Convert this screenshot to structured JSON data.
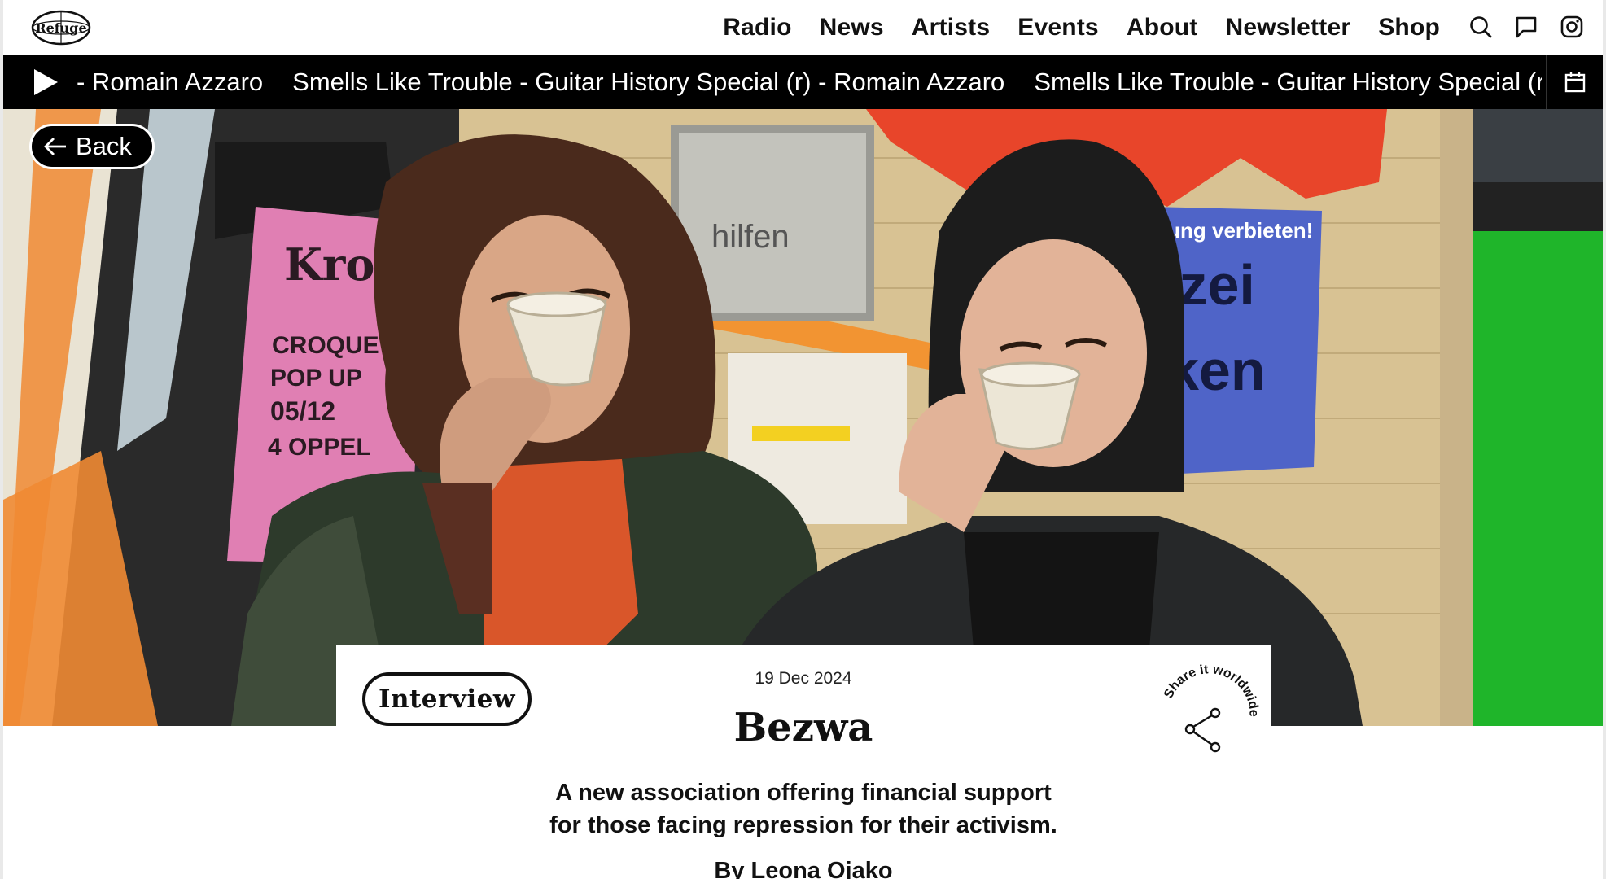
{
  "header": {
    "logo_text": "Refuge",
    "nav": [
      "Radio",
      "News",
      "Artists",
      "Events",
      "About",
      "Newsletter",
      "Shop"
    ],
    "icons": [
      "search-icon",
      "chat-icon",
      "instagram-icon"
    ]
  },
  "ticker": {
    "items": [
      "- Romain Azzaro",
      "Smells Like Trouble - Guitar History Special (r) - Romain Azzaro",
      "Smells Like Trouble - Guitar History Special (r) - Romain Azzaro"
    ]
  },
  "hero": {
    "back_label": "Back",
    "poster_left_lines": [
      "Kroc",
      "CROQUE",
      "POP UP",
      "05/12",
      "4 OPPEL"
    ],
    "poster_right_lines": [
      "rung verbieten!",
      "izei",
      "ken"
    ],
    "sign_text": "hilfen"
  },
  "article": {
    "tag": "Interview",
    "date": "19 Dec 2024",
    "title": "Bezwa",
    "subtitle_line1": "A new association offering financial support",
    "subtitle_line2": "for those facing repression for their activism.",
    "byline": "By Leona Ojako",
    "share_text": "Share it worldwide"
  },
  "colors": {
    "ticker_bg": "#000000",
    "accent_green": "#1fb52a",
    "accent_orange": "#e8561e",
    "poster_pink": "#e07fb3",
    "poster_blue": "#4f64c8"
  }
}
